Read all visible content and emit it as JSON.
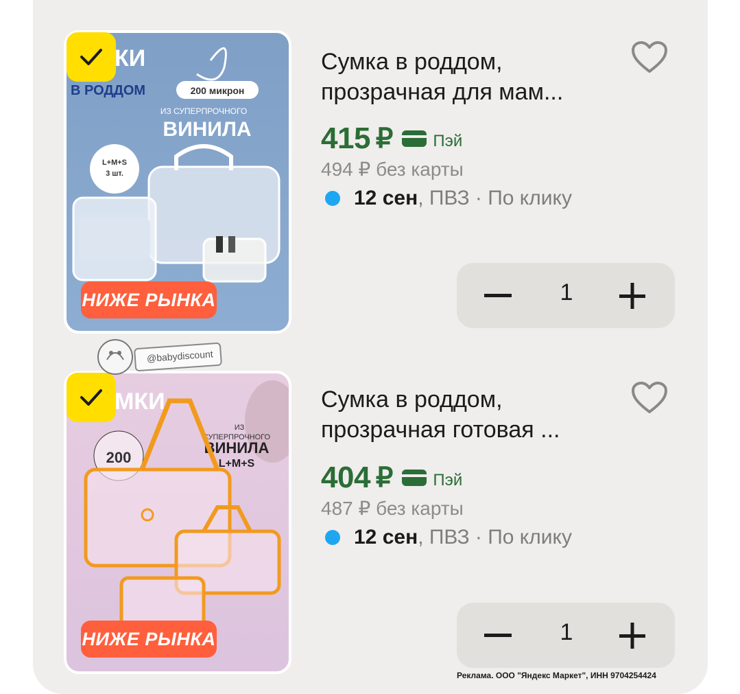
{
  "products": [
    {
      "title_line1": "Сумка в роддом,",
      "title_line2": "прозрачная для мам...",
      "price": "415",
      "currency": "₽",
      "pay_label": "Пэй",
      "old_price": "494 ₽  без карты",
      "delivery_date": "12 сен",
      "delivery_rest": ", ПВЗ · По клику",
      "quantity": "1",
      "badge": "НИЖЕ РЫНКА",
      "selected": true
    },
    {
      "title_line1": "Сумка в роддом,",
      "title_line2": "прозрачная готовая ...",
      "price": "404",
      "currency": "₽",
      "pay_label": "Пэй",
      "old_price": "487 ₽  без карты",
      "delivery_date": "12 сен",
      "delivery_rest": ", ПВЗ · По клику",
      "quantity": "1",
      "badge": "НИЖЕ РЫНКА",
      "selected": true
    }
  ],
  "image1": {
    "line_a": "200 микрон",
    "line_b": "ИЗ СУПЕРПРОЧНОГО",
    "line_c": "ВИНИЛА",
    "line_d": "L+M+S",
    "line_e": "3 шт.",
    "word": "КИ",
    "word2": "В РОДДОМ"
  },
  "image2": {
    "line_a": "ИЗ",
    "line_b": "СУПЕРПРОЧНОГО",
    "line_c": "ВИНИЛА",
    "line_d": "L+M+S",
    "line_e": "200",
    "word": "МКИ"
  },
  "watermark": "@babydiscount",
  "ad_text": "Реклама. ООО \"Яндекс Маркет\", ИНН 9704254424",
  "colors": {
    "price_green": "#2b6d36",
    "check_yellow": "#ffde00",
    "badge_orange": "#ff5f3d",
    "dot_blue": "#1ea6f2"
  }
}
